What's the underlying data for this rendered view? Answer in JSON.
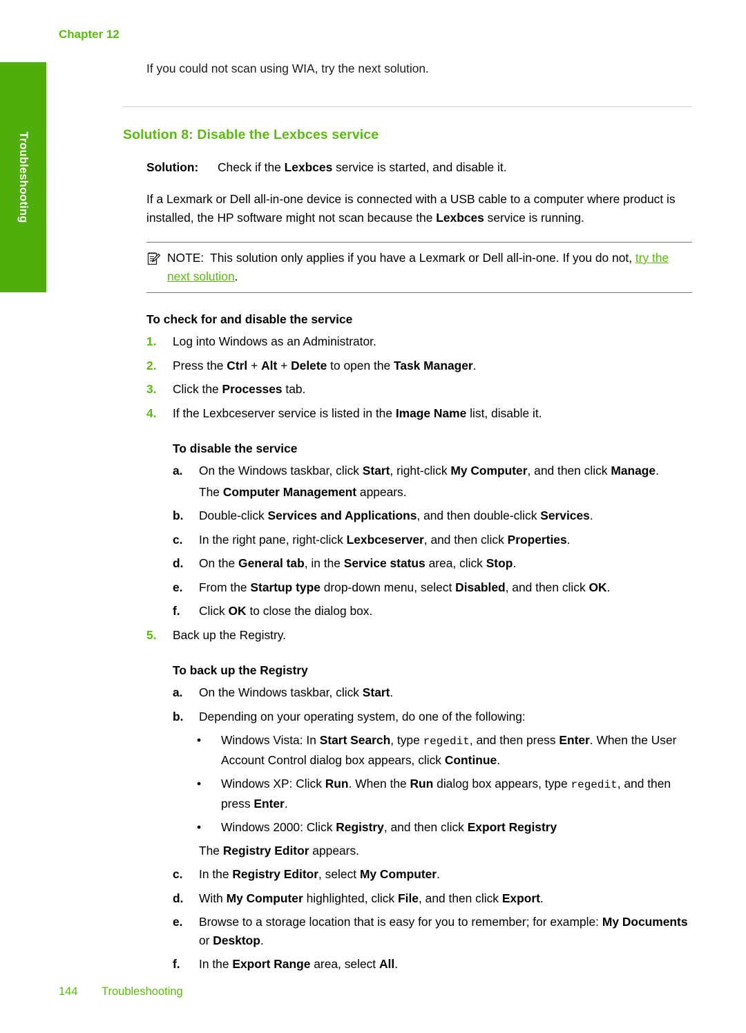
{
  "page": {
    "chapter_header": "Chapter 12",
    "side_tab_label": "Troubleshooting",
    "accent_green": "#5aba10",
    "tab_green": "#4fae0b"
  },
  "intro": {
    "paragraph": "If you could not scan using WIA, try the next solution."
  },
  "solution": {
    "heading": "Solution 8: Disable the Lexbces service",
    "label": "Solution:",
    "summary_pre": "Check if the ",
    "summary_bold": "Lexbces",
    "summary_post": " service is started, and disable it.",
    "body_1": "If a Lexmark or Dell all-in-one device is connected with a USB cable to a computer where product is installed, the HP software might not scan because the ",
    "body_bold": "Lexbces",
    "body_2": " service is running."
  },
  "note": {
    "icon": "note-pencil-icon",
    "label": "NOTE:",
    "text_1": "This solution only applies if you have a Lexmark or Dell all-in-one. If you do not, ",
    "link_text": "try the next solution",
    "text_2": "."
  },
  "procedure_check": {
    "heading": "To check for and disable the service",
    "items": [
      {
        "marker": "1.",
        "parts": [
          {
            "t": "Log into Windows as an Administrator.",
            "b": false
          }
        ]
      },
      {
        "marker": "2.",
        "parts": [
          {
            "t": "Press the ",
            "b": false
          },
          {
            "t": "Ctrl",
            "b": true
          },
          {
            "t": " + ",
            "b": false
          },
          {
            "t": "Alt",
            "b": true
          },
          {
            "t": " + ",
            "b": false
          },
          {
            "t": "Delete",
            "b": true
          },
          {
            "t": " to open the ",
            "b": false
          },
          {
            "t": "Task Manager",
            "b": true
          },
          {
            "t": ".",
            "b": false
          }
        ]
      },
      {
        "marker": "3.",
        "parts": [
          {
            "t": "Click the ",
            "b": false
          },
          {
            "t": "Processes",
            "b": true
          },
          {
            "t": " tab.",
            "b": false
          }
        ]
      },
      {
        "marker": "4.",
        "parts": [
          {
            "t": "If the Lexbceserver service is listed in the ",
            "b": false
          },
          {
            "t": "Image Name",
            "b": true
          },
          {
            "t": " list, disable it.",
            "b": false
          }
        ]
      }
    ]
  },
  "procedure_disable": {
    "heading": "To disable the service",
    "items": [
      {
        "marker": "a.",
        "parts": [
          {
            "t": "On the Windows taskbar, click ",
            "b": false
          },
          {
            "t": "Start",
            "b": true
          },
          {
            "t": ", right-click ",
            "b": false
          },
          {
            "t": "My Computer",
            "b": true
          },
          {
            "t": ", and then click ",
            "b": false
          },
          {
            "t": "Manage",
            "b": true
          },
          {
            "t": ".",
            "b": false
          }
        ],
        "follow": [
          {
            "t": "The ",
            "b": false
          },
          {
            "t": "Computer Management",
            "b": true
          },
          {
            "t": " appears.",
            "b": false
          }
        ]
      },
      {
        "marker": "b.",
        "parts": [
          {
            "t": "Double-click ",
            "b": false
          },
          {
            "t": "Services and Applications",
            "b": true
          },
          {
            "t": ", and then double-click ",
            "b": false
          },
          {
            "t": "Services",
            "b": true
          },
          {
            "t": ".",
            "b": false
          }
        ]
      },
      {
        "marker": "c.",
        "parts": [
          {
            "t": "In the right pane, right-click ",
            "b": false
          },
          {
            "t": "Lexbceserver",
            "b": true
          },
          {
            "t": ", and then click ",
            "b": false
          },
          {
            "t": "Properties",
            "b": true
          },
          {
            "t": ".",
            "b": false
          }
        ]
      },
      {
        "marker": "d.",
        "parts": [
          {
            "t": "On the ",
            "b": false
          },
          {
            "t": "General tab",
            "b": true
          },
          {
            "t": ", in the ",
            "b": false
          },
          {
            "t": "Service status",
            "b": true
          },
          {
            "t": " area, click ",
            "b": false
          },
          {
            "t": "Stop",
            "b": true
          },
          {
            "t": ".",
            "b": false
          }
        ]
      },
      {
        "marker": "e.",
        "parts": [
          {
            "t": "From the ",
            "b": false
          },
          {
            "t": "Startup type",
            "b": true
          },
          {
            "t": " drop-down menu, select ",
            "b": false
          },
          {
            "t": "Disabled",
            "b": true
          },
          {
            "t": ", and then click ",
            "b": false
          },
          {
            "t": "OK",
            "b": true
          },
          {
            "t": ".",
            "b": false
          }
        ]
      },
      {
        "marker": "f.",
        "parts": [
          {
            "t": "Click ",
            "b": false
          },
          {
            "t": "OK",
            "b": true
          },
          {
            "t": " to close the dialog box.",
            "b": false
          }
        ]
      }
    ]
  },
  "step5": {
    "marker": "5.",
    "text": "Back up the Registry."
  },
  "procedure_backup": {
    "heading": "To back up the Registry",
    "items": [
      {
        "marker": "a.",
        "parts": [
          {
            "t": "On the Windows taskbar, click ",
            "b": false
          },
          {
            "t": "Start",
            "b": true
          },
          {
            "t": ".",
            "b": false
          }
        ]
      },
      {
        "marker": "b.",
        "parts": [
          {
            "t": "Depending on your operating system, do one of the following:",
            "b": false
          }
        ]
      }
    ],
    "bullets": [
      {
        "marker": "•",
        "parts": [
          {
            "t": "Windows Vista: In ",
            "b": false
          },
          {
            "t": "Start Search",
            "b": true
          },
          {
            "t": ", type ",
            "b": false
          },
          {
            "t": "regedit",
            "b": false,
            "m": true
          },
          {
            "t": ", and then press ",
            "b": false
          },
          {
            "t": "Enter",
            "b": true
          },
          {
            "t": ". When the User Account Control dialog box appears, click ",
            "b": false
          },
          {
            "t": "Continue",
            "b": true
          },
          {
            "t": ".",
            "b": false
          }
        ]
      },
      {
        "marker": "•",
        "parts": [
          {
            "t": "Windows XP: Click ",
            "b": false
          },
          {
            "t": "Run",
            "b": true
          },
          {
            "t": ". When the ",
            "b": false
          },
          {
            "t": "Run",
            "b": true
          },
          {
            "t": " dialog box appears, type ",
            "b": false
          },
          {
            "t": "regedit",
            "b": false,
            "m": true
          },
          {
            "t": ", and then press ",
            "b": false
          },
          {
            "t": "Enter",
            "b": true
          },
          {
            "t": ".",
            "b": false
          }
        ]
      },
      {
        "marker": "•",
        "parts": [
          {
            "t": "Windows 2000: Click ",
            "b": false
          },
          {
            "t": "Registry",
            "b": true
          },
          {
            "t": ", and then click ",
            "b": false
          },
          {
            "t": "Export Registry",
            "b": true
          }
        ]
      }
    ],
    "after_bullets": [
      {
        "t": "The ",
        "b": false
      },
      {
        "t": "Registry Editor",
        "b": true
      },
      {
        "t": " appears.",
        "b": false
      }
    ],
    "items_cont": [
      {
        "marker": "c.",
        "parts": [
          {
            "t": "In the ",
            "b": false
          },
          {
            "t": "Registry Editor",
            "b": true
          },
          {
            "t": ", select ",
            "b": false
          },
          {
            "t": "My Computer",
            "b": true
          },
          {
            "t": ".",
            "b": false
          }
        ]
      },
      {
        "marker": "d.",
        "parts": [
          {
            "t": "With ",
            "b": false
          },
          {
            "t": "My Computer",
            "b": true
          },
          {
            "t": " highlighted, click ",
            "b": false
          },
          {
            "t": "File",
            "b": true
          },
          {
            "t": ", and then click ",
            "b": false
          },
          {
            "t": "Export",
            "b": true
          },
          {
            "t": ".",
            "b": false
          }
        ]
      },
      {
        "marker": "e.",
        "parts": [
          {
            "t": "Browse to a storage location that is easy for you to remember; for example: ",
            "b": false
          },
          {
            "t": "My Documents",
            "b": true
          },
          {
            "t": " or ",
            "b": false
          },
          {
            "t": "Desktop",
            "b": true
          },
          {
            "t": ".",
            "b": false
          }
        ]
      },
      {
        "marker": "f.",
        "parts": [
          {
            "t": "In the ",
            "b": false
          },
          {
            "t": "Export Range",
            "b": true
          },
          {
            "t": " area, select ",
            "b": false
          },
          {
            "t": "All",
            "b": true
          },
          {
            "t": ".",
            "b": false
          }
        ]
      }
    ]
  },
  "footer": {
    "page_number": "144",
    "section": "Troubleshooting"
  }
}
